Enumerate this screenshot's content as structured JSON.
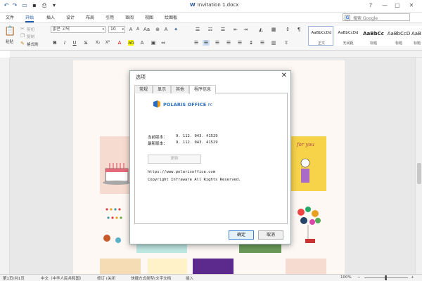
{
  "titlebar": {
    "document_title": "Invitation 1.docx",
    "word_glyph": "W"
  },
  "tabs": [
    {
      "label": "文件",
      "active": false
    },
    {
      "label": "开始",
      "active": true
    },
    {
      "label": "插入",
      "active": false
    },
    {
      "label": "设计",
      "active": false
    },
    {
      "label": "布局",
      "active": false
    },
    {
      "label": "引用",
      "active": false
    },
    {
      "label": "审阅",
      "active": false
    },
    {
      "label": "视图",
      "active": false
    },
    {
      "label": "绘图板",
      "active": false
    }
  ],
  "search": {
    "g": "G",
    "placeholder": "搜索 Google"
  },
  "ribbon": {
    "paste_label": "粘贴",
    "cut_label": "剪切",
    "copy_label": "复制",
    "format_painter_label": "格式刷",
    "font_name": "맑은 고딕",
    "font_size": "10",
    "styles": [
      {
        "preview": "AaBbCcDd",
        "name": "正文"
      },
      {
        "preview": "AaBbCcDd",
        "name": "无间距"
      },
      {
        "preview": "AaBbCc",
        "name": "标题"
      },
      {
        "preview": "AaBbCcD",
        "name": "标题"
      },
      {
        "preview": "AaBbCcD",
        "name": "标题"
      }
    ]
  },
  "dialog": {
    "title": "选项",
    "tabs": [
      "常规",
      "显示",
      "其他",
      "程序信息"
    ],
    "active_tab": "程序信息",
    "logo_text": "POLARIS OFFICE",
    "logo_suffix": "PC",
    "current_version_label": "当前版本：",
    "current_version": "9. 112. 043. 41529",
    "latest_version_label": "最新版本：",
    "latest_version": "9. 112. 043. 41529",
    "update_button": "更新",
    "url": "https://www.polarisoffice.com",
    "copyright": "Copyright Infraware All Rights Reserved.",
    "ok_button": "确定",
    "cancel_button": "取消"
  },
  "statusbar": {
    "page": "第1页/共1页",
    "language": "中文（中华人民共和国）",
    "track_changes": "修订 (关闭",
    "input_mode": "快捷方式类型(文字文档",
    "insert": "插入",
    "zoom": "100%"
  },
  "colors": {
    "accent": "#1e5aa8",
    "logo_blue": "#2a6ebb"
  }
}
